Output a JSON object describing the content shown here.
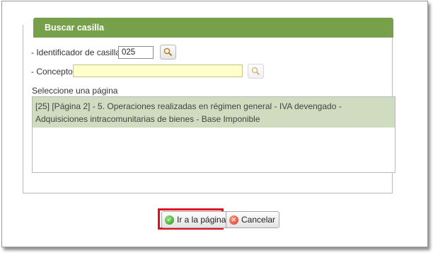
{
  "dialog": {
    "title": "Buscar casilla",
    "id_label": "- Identificador de casilla",
    "id_value": "025",
    "concept_label": "- Concepto",
    "concept_value": "",
    "list_label": "Seleccione una página",
    "list_items": [
      "[25] [Página 2] - 5. Operaciones realizadas en régimen general - IVA devengado - Adquisiciones intracomunitarias de bienes - Base Imponible"
    ],
    "go_button": "Ir a la página",
    "cancel_button": "Cancelar"
  },
  "icons": {
    "search": "magnifier-icon",
    "ok": "check-circle-icon",
    "cancel": "x-circle-icon"
  },
  "colors": {
    "header": "#76a04a",
    "selected_row": "#cfdcbf",
    "concept_bg": "#ffffcc",
    "highlight": "#e0101e"
  }
}
